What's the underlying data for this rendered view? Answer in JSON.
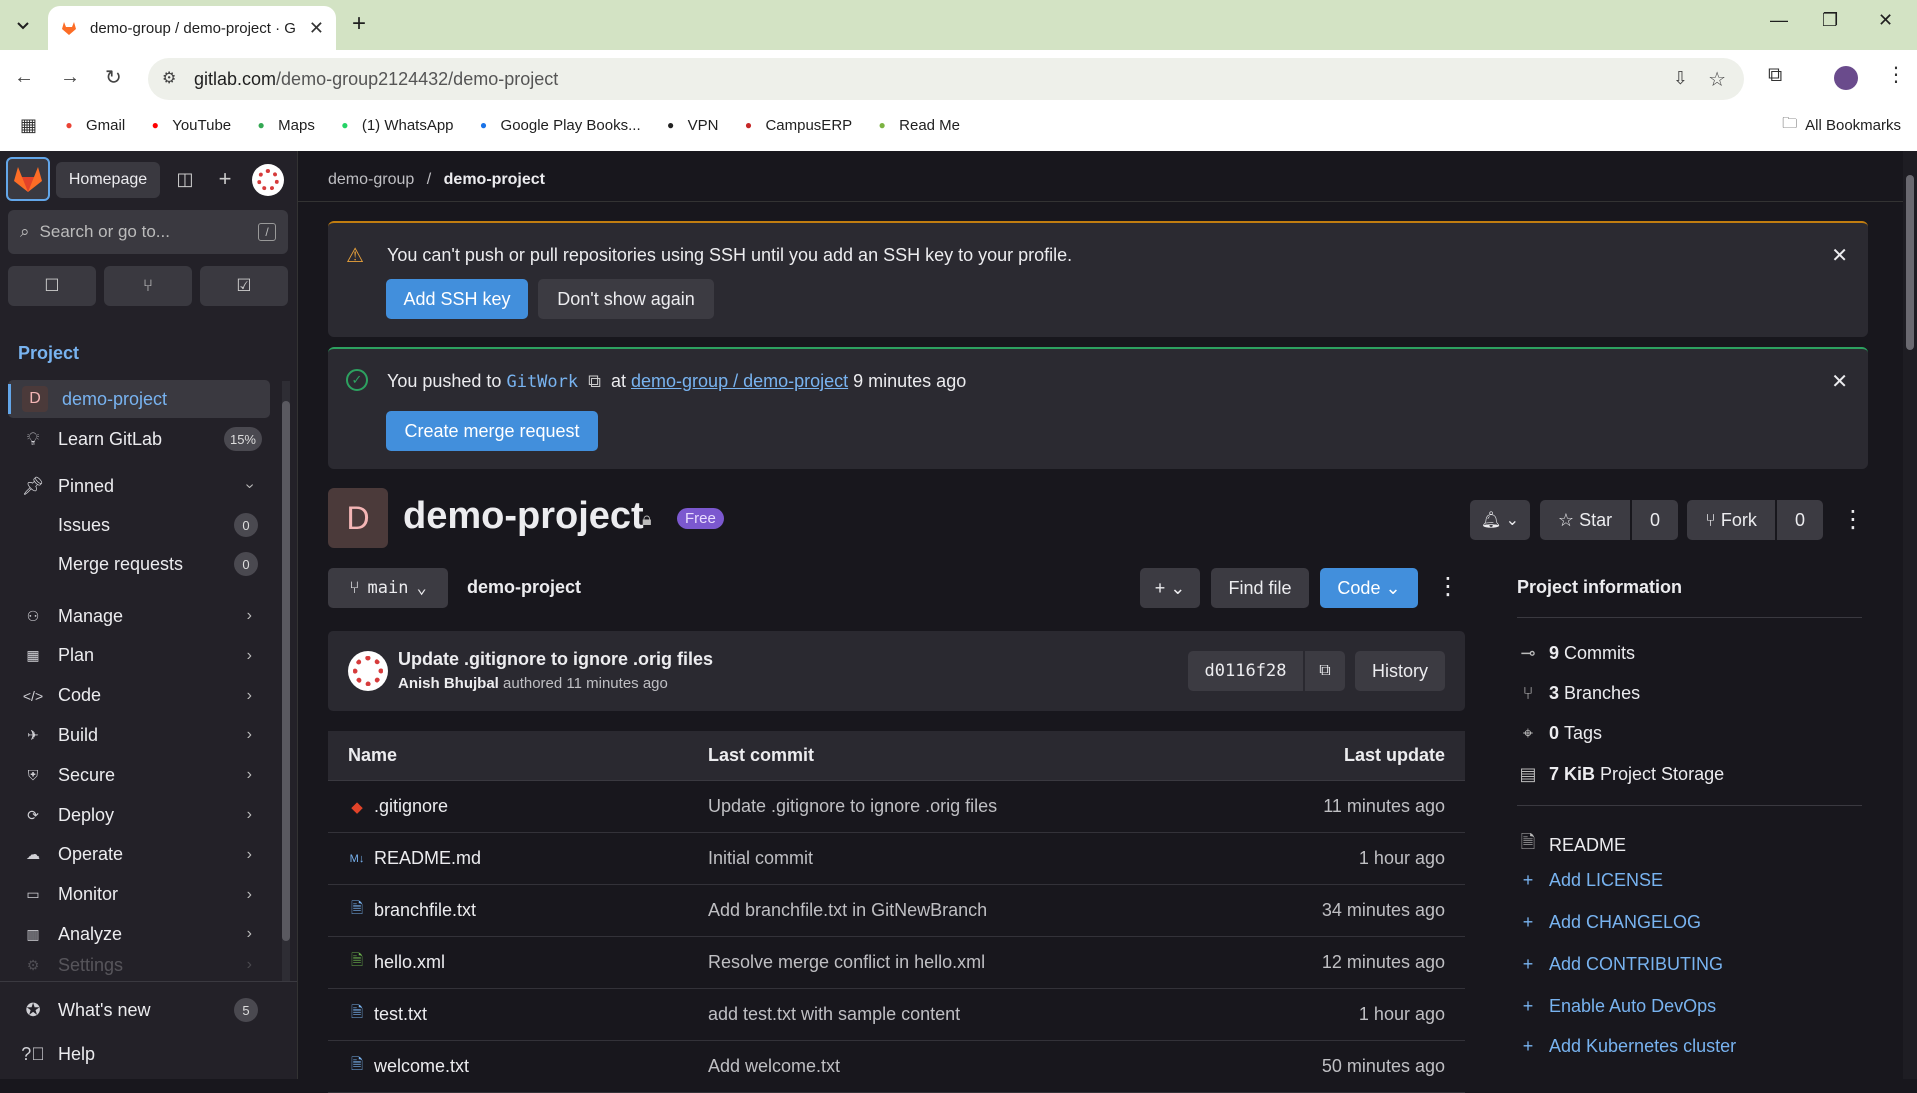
{
  "browser": {
    "tab_title": "demo-group / demo-project · G",
    "url_host": "gitlab.com",
    "url_path": "/demo-group2124432/demo-project",
    "bookmarks": [
      {
        "label": "Gmail",
        "icon": "gmail-icon",
        "color": "#ea4335"
      },
      {
        "label": "YouTube",
        "icon": "youtube-icon",
        "color": "#ff0000"
      },
      {
        "label": "Maps",
        "icon": "maps-icon",
        "color": "#34a853"
      },
      {
        "label": "(1) WhatsApp",
        "icon": "whatsapp-icon",
        "color": "#25d366"
      },
      {
        "label": "Google Play Books...",
        "icon": "play-books-icon",
        "color": "#1a73e8"
      },
      {
        "label": "VPN",
        "icon": "vpn-icon",
        "color": "#222222"
      },
      {
        "label": "CampusERP",
        "icon": "campuserp-icon",
        "color": "#c62828"
      },
      {
        "label": "Read Me",
        "icon": "readme-icon",
        "color": "#7cb342"
      }
    ],
    "all_bookmarks": "All Bookmarks"
  },
  "sidebar": {
    "homepage": "Homepage",
    "search_placeholder": "Search or go to...",
    "search_shortcut": "/",
    "section": "Project",
    "project_initial": "D",
    "project_name": "demo-project",
    "learn": "Learn GitLab",
    "learn_pct": "15%",
    "pinned": "Pinned",
    "issues": "Issues",
    "issues_count": "0",
    "merge_requests": "Merge requests",
    "mr_count": "0",
    "groups": [
      "Manage",
      "Plan",
      "Code",
      "Build",
      "Secure",
      "Deploy",
      "Operate",
      "Monitor",
      "Analyze",
      "Settings"
    ],
    "whats_new": "What's new",
    "whats_new_count": "5",
    "help": "Help"
  },
  "breadcrumb": {
    "group": "demo-group",
    "sep": "/",
    "project": "demo-project"
  },
  "ssh_alert": {
    "text": "You can't push or pull repositories using SSH until you add an SSH key to your profile.",
    "add": "Add SSH key",
    "dismiss": "Don't show again"
  },
  "push_alert": {
    "pre": "You pushed to",
    "branch": "GitWork",
    "at": "at",
    "project_link": "demo-group / demo-project",
    "time": "9 minutes ago",
    "button": "Create merge request"
  },
  "project": {
    "initial": "D",
    "name": "demo-project",
    "badge": "Free",
    "star": "Star",
    "star_count": "0",
    "fork": "Fork",
    "fork_count": "0"
  },
  "repo": {
    "branch": "main",
    "path": "demo-project",
    "find_file": "Find file",
    "code": "Code",
    "commit_title": "Update .gitignore to ignore .orig files",
    "commit_author": "Anish Bhujbal",
    "commit_meta": "authored 11 minutes ago",
    "sha": "d0116f28",
    "history": "History"
  },
  "table": {
    "headers": [
      "Name",
      "Last commit",
      "Last update"
    ],
    "rows": [
      {
        "name": ".gitignore",
        "commit": "Update .gitignore to ignore .orig files",
        "time": "11 minutes ago",
        "icon": "git-icon"
      },
      {
        "name": "README.md",
        "commit": "Initial commit",
        "time": "1 hour ago",
        "icon": "markdown-icon"
      },
      {
        "name": "branchfile.txt",
        "commit": "Add branchfile.txt in GitNewBranch",
        "time": "34 minutes ago",
        "icon": "file-icon"
      },
      {
        "name": "hello.xml",
        "commit": "Resolve merge conflict in hello.xml",
        "time": "12 minutes ago",
        "icon": "xml-icon"
      },
      {
        "name": "test.txt",
        "commit": "add test.txt with sample content",
        "time": "1 hour ago",
        "icon": "file-icon"
      },
      {
        "name": "welcome.txt",
        "commit": "Add welcome.txt",
        "time": "50 minutes ago",
        "icon": "file-icon"
      }
    ]
  },
  "info": {
    "title": "Project information",
    "commits_n": "9",
    "commits": "Commits",
    "branches_n": "3",
    "branches": "Branches",
    "tags_n": "0",
    "tags": "Tags",
    "storage_n": "7 KiB",
    "storage": "Project Storage",
    "readme": "README",
    "add_license": "Add LICENSE",
    "add_changelog": "Add CHANGELOG",
    "add_contributing": "Add CONTRIBUTING",
    "auto_devops": "Enable Auto DevOps",
    "kubernetes": "Add Kubernetes cluster"
  }
}
